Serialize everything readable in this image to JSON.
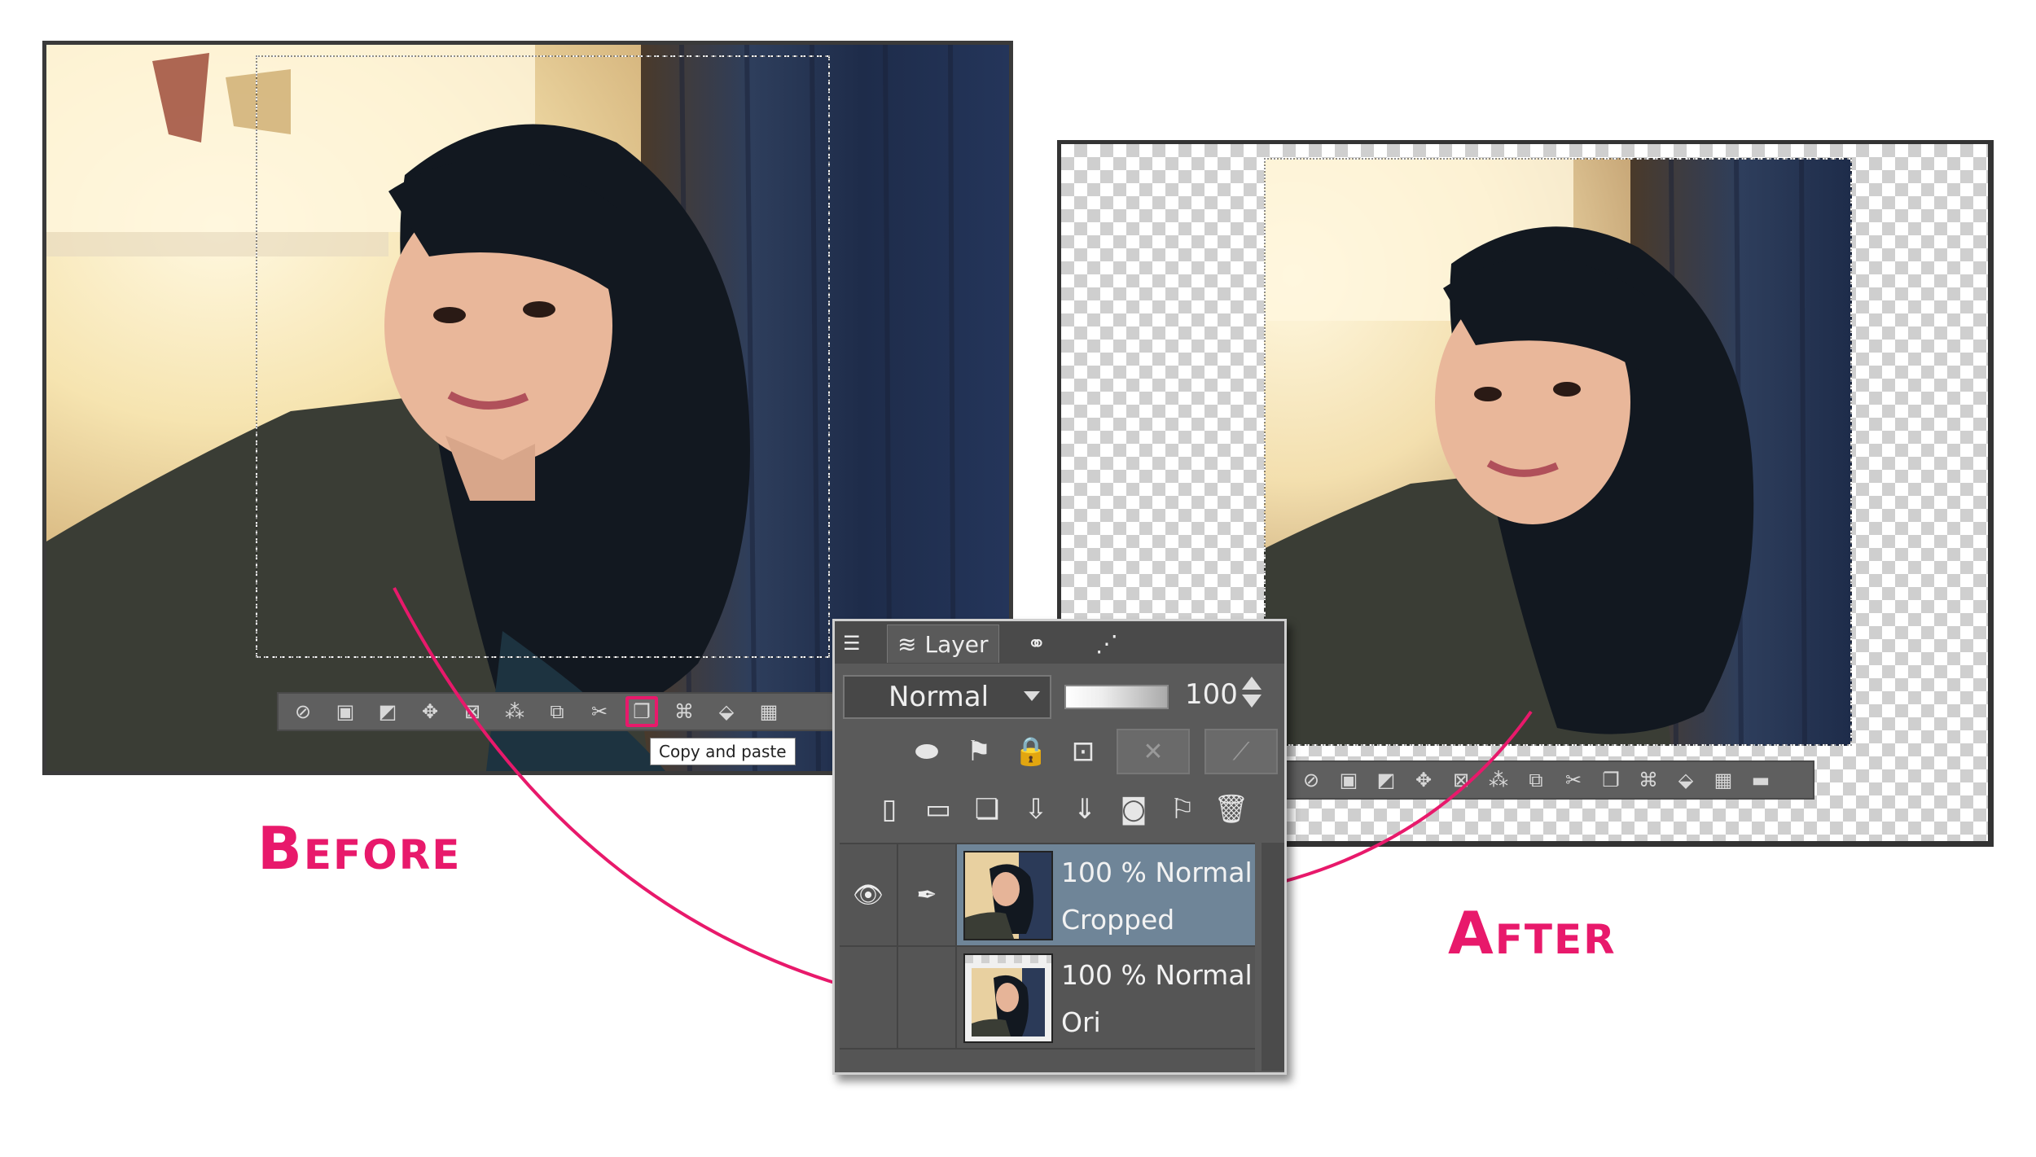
{
  "before": {
    "label": "Before",
    "toolbar_icons": [
      "deselect-icon",
      "select-all-icon",
      "invert-selection-icon",
      "expand-selection-icon",
      "shrink-selection-icon",
      "convert-lines-icon",
      "fill-selection-icon",
      "clear-outside-icon",
      "copy-and-paste-icon",
      "transform-icon",
      "fill-icon",
      "checker-icon",
      "more-icon"
    ],
    "highlighted_button": "Copy and paste",
    "tooltip": "Copy and paste"
  },
  "after": {
    "label": "After",
    "toolbar_icons": [
      "deselect-icon",
      "select-all-icon",
      "invert-selection-icon",
      "expand-selection-icon",
      "shrink-selection-icon",
      "convert-lines-icon",
      "fill-selection-icon",
      "clear-outside-icon",
      "copy-and-paste-icon",
      "transform-icon",
      "fill-icon",
      "checker-icon",
      "more-icon"
    ]
  },
  "layer_panel": {
    "tab_label": "Layer",
    "blend_mode": "Normal",
    "opacity": "100",
    "layers": [
      {
        "opacity_mode": "100 % Normal",
        "name": "Cropped",
        "selected": true
      },
      {
        "opacity_mode": "100 % Normal",
        "name": "Ori",
        "selected": false
      }
    ]
  },
  "colors": {
    "accent": "#e8196b",
    "panel_bg": "#5a5a5a",
    "selected_layer": "#6f8598"
  }
}
